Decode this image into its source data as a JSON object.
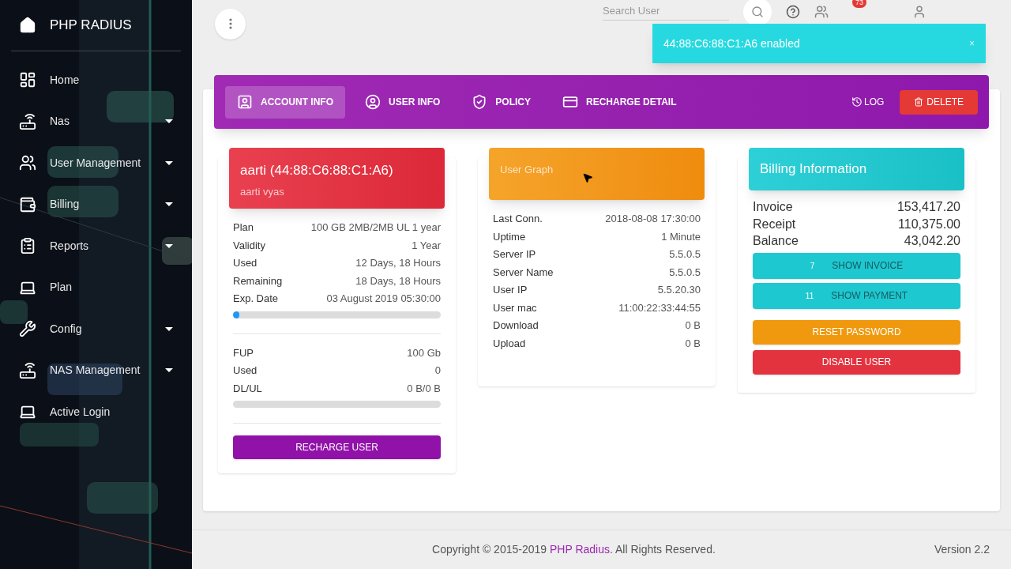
{
  "sidebar": {
    "brand": "PHP RADIUS",
    "items": [
      {
        "label": "Home",
        "expandable": false
      },
      {
        "label": "Nas",
        "expandable": true
      },
      {
        "label": "User Management",
        "expandable": true
      },
      {
        "label": "Billing",
        "expandable": true
      },
      {
        "label": "Reports",
        "expandable": true
      },
      {
        "label": "Plan",
        "expandable": false
      },
      {
        "label": "Config",
        "expandable": true
      },
      {
        "label": "NAS Management",
        "expandable": true
      },
      {
        "label": "Active Login",
        "expandable": false
      }
    ]
  },
  "topbar": {
    "search": {
      "placeholder": "Search User"
    },
    "users_badge": "73"
  },
  "toast": {
    "message": "44:88:C6:88:C1:A6 enabled",
    "close": "×"
  },
  "tabs": [
    {
      "label": "ACCOUNT INFO",
      "selected": true
    },
    {
      "label": "USER INFO",
      "selected": false
    },
    {
      "label": "POLICY",
      "selected": false
    },
    {
      "label": "RECHARGE DETAIL",
      "selected": false
    }
  ],
  "tab_actions": {
    "log": "LOG",
    "delete": "DELETE"
  },
  "account": {
    "title": "aarti (44:88:C6:88:C1:A6)",
    "subtitle": "aarti vyas",
    "rows": [
      {
        "label": "Plan",
        "value": "100 GB 2MB/2MB UL 1 year"
      },
      {
        "label": "Validity",
        "value": "1 Year"
      },
      {
        "label": "Used",
        "value": "12 Days, 18 Hours"
      },
      {
        "label": "Remaining",
        "value": "18 Days, 18 Hours"
      },
      {
        "label": "Exp. Date",
        "value": "03 August 2019 05:30:00"
      }
    ],
    "validity_bar": {
      "level": 0.03
    },
    "usage_rows": [
      {
        "label": "FUP",
        "value": "100 Gb"
      },
      {
        "label": "Used",
        "value": "0"
      },
      {
        "label": "DL/UL",
        "value": "0 B/0 B"
      }
    ],
    "usage_bar": {
      "level": 0
    },
    "recharge": "RECHARGE USER"
  },
  "graph": {
    "title": "User Graph",
    "rows": [
      {
        "label": "Last Conn.",
        "value": "2018-08-08 17:30:00"
      },
      {
        "label": "Uptime",
        "value": "1 Minute"
      },
      {
        "label": "Server IP",
        "value": "5.5.0.5"
      },
      {
        "label": "Server Name",
        "value": "5.5.0.5"
      },
      {
        "label": "User IP",
        "value": "5.5.20.30"
      },
      {
        "label": "User mac",
        "value": "11:00:22:33:44:55"
      },
      {
        "label": "Download",
        "value": "0 B"
      },
      {
        "label": "Upload",
        "value": "0 B"
      }
    ]
  },
  "billing": {
    "title": "Billing Information",
    "rows": [
      {
        "label": "Invoice",
        "value": "153,417.20"
      },
      {
        "label": "Receipt",
        "value": "110,375.00"
      },
      {
        "label": "Balance",
        "value": "43,042.20"
      }
    ],
    "links": [
      {
        "count": "7",
        "label": "SHOW INVOICE"
      },
      {
        "count": "11",
        "label": "SHOW PAYMENT"
      }
    ],
    "actions": [
      {
        "label": "RESET PASSWORD",
        "color": "#f0990e"
      },
      {
        "label": "DISABLE USER",
        "color": "#e3333f"
      }
    ]
  },
  "footer": {
    "copyright": "Copyright © 2015-2019 **PHP Radius**. All Rights Reserved.",
    "version": "Version 2.2"
  }
}
